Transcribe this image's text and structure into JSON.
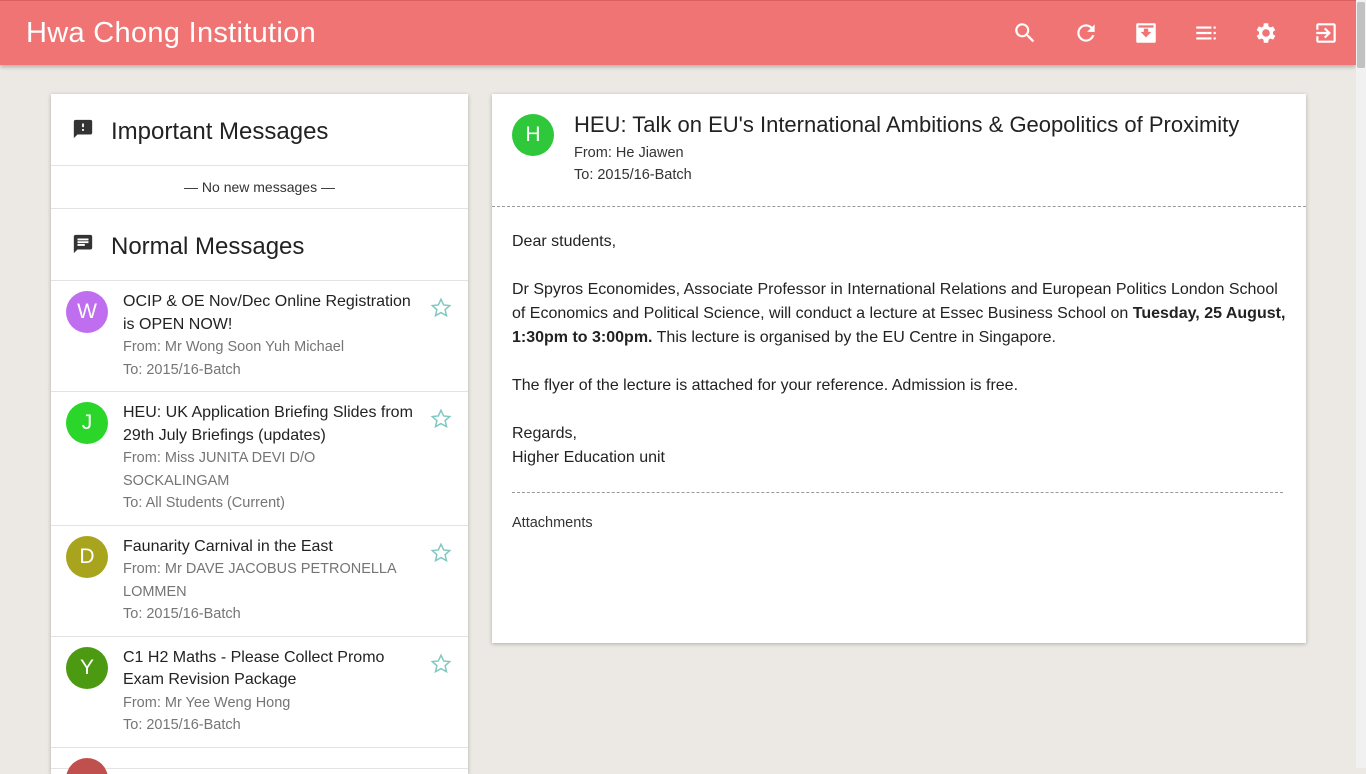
{
  "header": {
    "title": "Hwa Chong Institution",
    "icons": [
      "search-icon",
      "refresh-icon",
      "archive-icon",
      "list-icon",
      "settings-icon",
      "logout-icon"
    ],
    "color": "#f07474"
  },
  "important": {
    "title": "Important Messages",
    "empty_text": "— No new messages —"
  },
  "normal": {
    "title": "Normal Messages",
    "messages": [
      {
        "initial": "W",
        "color": "#c06ef0",
        "subject": "OCIP & OE Nov/Dec Online Registration is OPEN NOW!",
        "from": "From: Mr Wong Soon Yuh Michael",
        "to": "To: 2015/16-Batch"
      },
      {
        "initial": "J",
        "color": "#2ad62a",
        "subject": "HEU: UK Application Briefing Slides from 29th July Briefings (updates)",
        "from": "From: Miss JUNITA DEVI D/O SOCKALINGAM",
        "to": "To: All Students (Current)"
      },
      {
        "initial": "D",
        "color": "#a8a41e",
        "subject": "Faunarity Carnival in the East",
        "from": "From: Mr DAVE JACOBUS PETRONELLA LOMMEN",
        "to": "To: 2015/16-Batch"
      },
      {
        "initial": "Y",
        "color": "#4c9a12",
        "subject": "C1 H2 Maths - Please Collect Promo Exam Revision Package",
        "from": "From: Mr Yee Weng Hong",
        "to": "To: 2015/16-Batch"
      },
      {
        "initial": "",
        "color": "#c0504d",
        "subject": "",
        "from": "",
        "to": ""
      }
    ]
  },
  "detail": {
    "initial": "H",
    "subject": "HEU: Talk on EU's International Ambitions & Geopolitics of Proximity",
    "from": "From: He Jiawen",
    "to": "To: 2015/16-Batch",
    "greeting": "Dear students,",
    "para1_start": "Dr Spyros Economides, Associate Professor in International Relations and European Politics London School of Economics and Political Science, will conduct a lecture at Essec Business School on ",
    "para1_bold": "Tuesday, 25 August, 1:30pm to 3:00pm.",
    "para1_end": " This lecture is organised by the EU Centre in Singapore.",
    "para2": "The flyer of the lecture is attached for your reference. Admission is free.",
    "signoff1": "Regards,",
    "signoff2": "Higher Education unit",
    "attachments_label": "Attachments"
  }
}
